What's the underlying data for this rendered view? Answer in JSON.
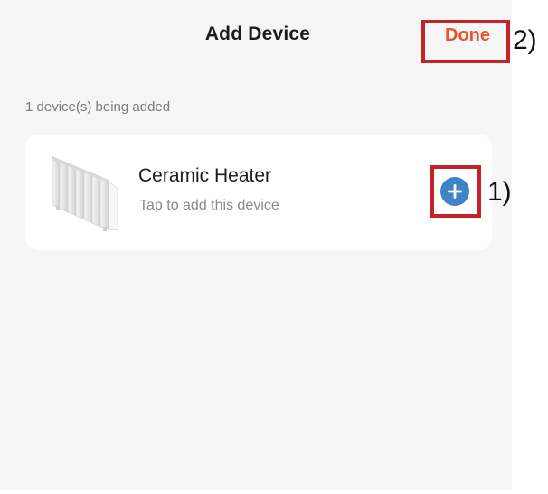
{
  "header": {
    "title": "Add Device",
    "done_label": "Done"
  },
  "status": {
    "text": "1 device(s) being added"
  },
  "device": {
    "name": "Ceramic Heater",
    "hint": "Tap to add this device",
    "image_icon": "ceramic-heater-image",
    "add_icon": "plus-circle-icon"
  },
  "annotations": {
    "done_marker": "2)",
    "add_marker": "1)"
  },
  "colors": {
    "accent": "#e8562a",
    "add_button": "#3f84c8",
    "highlight": "#c4232b",
    "background": "#f6f6f6"
  }
}
